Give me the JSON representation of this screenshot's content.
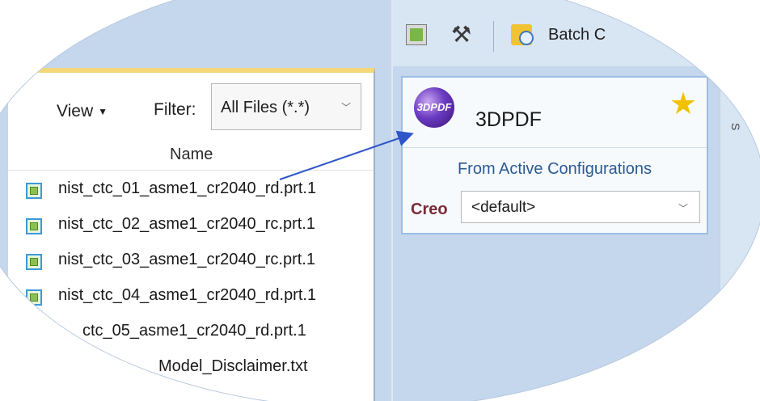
{
  "file_dialog": {
    "view_label": "View",
    "filter_label": "Filter:",
    "filter_value": "All Files (*.*)",
    "column_header": "Name",
    "files": [
      {
        "name": "nist_ctc_01_asme1_cr2040_rd.prt.1",
        "icon": "part-file-icon"
      },
      {
        "name": "nist_ctc_02_asme1_cr2040_rc.prt.1",
        "icon": "part-file-icon"
      },
      {
        "name": "nist_ctc_03_asme1_cr2040_rc.prt.1",
        "icon": "part-file-icon"
      },
      {
        "name": "nist_ctc_04_asme1_cr2040_rd.prt.1",
        "icon": "part-file-icon"
      },
      {
        "name": "ctc_05_asme1_cr2040_rd.prt.1",
        "icon": "part-file-icon"
      },
      {
        "name": "Model_Disclaimer.txt",
        "icon": "text-file-icon"
      }
    ]
  },
  "toolbar": {
    "batch_label": "Batch C",
    "icons": [
      "image-tool-icon",
      "tools-icon",
      "batch-icon"
    ]
  },
  "publish_card": {
    "icon_text": "3DPDF",
    "title": "3DPDF",
    "subtitle": "From Active Configurations",
    "creo_label": "Creo",
    "config_value": "<default>",
    "favorite_icon": "star-icon"
  },
  "colors": {
    "ellipse_bg": "#c5d7ec",
    "card_border": "#9bbde5",
    "subtitle_text": "#2a5a95",
    "creo_text": "#7b2a38",
    "arrow": "#2e56c9"
  }
}
